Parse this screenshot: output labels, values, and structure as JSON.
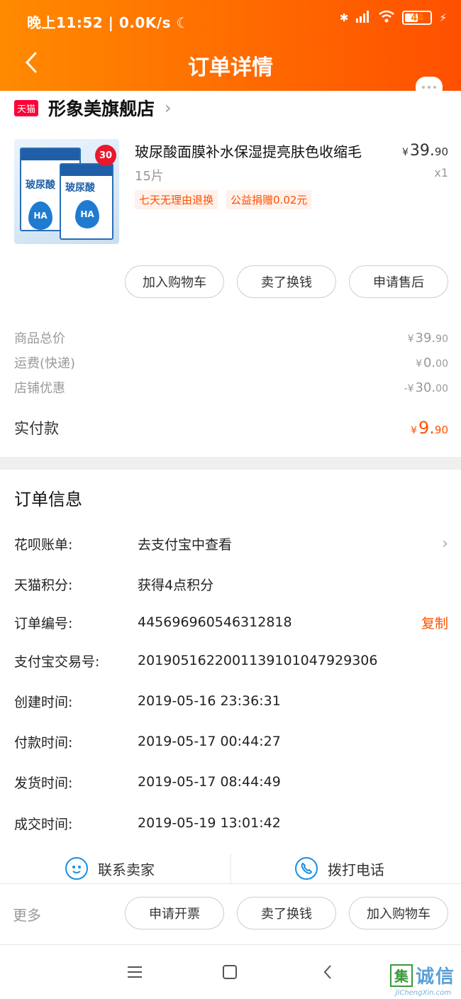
{
  "status_bar": {
    "time": "晚上11:52",
    "network_speed": "0.0K/s",
    "battery": "44"
  },
  "header": {
    "title": "订单详情",
    "gradient_start": "#ff8a00",
    "gradient_end": "#ff5000"
  },
  "store": {
    "badge": "天猫",
    "name": "形象美旗舰店"
  },
  "product": {
    "title": "玻尿酸面膜补水保湿提亮肤色收缩毛",
    "price_main": "39.",
    "price_cents": "90",
    "currency": "¥",
    "spec": "15片",
    "quantity": "x1",
    "tags": [
      "七天无理由退换",
      "公益捐赠0.02元"
    ],
    "image_text": {
      "brand_text": "玻尿酸",
      "ha_text": "HA",
      "count_badge": "30"
    }
  },
  "item_actions": [
    "加入购物车",
    "卖了换钱",
    "申请售后"
  ],
  "price_breakdown": [
    {
      "label": "商品总价",
      "prefix": "¥",
      "main": "39.",
      "cents": "90"
    },
    {
      "label": "运费(快递)",
      "prefix": "¥",
      "main": "0.",
      "cents": "00"
    },
    {
      "label": "店铺优惠",
      "prefix": "-¥",
      "main": "30.",
      "cents": "00"
    }
  ],
  "paid": {
    "label": "实付款",
    "prefix": "¥",
    "main": "9.",
    "cents": "90"
  },
  "order_info": {
    "title": "订单信息",
    "rows": [
      {
        "label": "花呗账单:",
        "value": "去支付宝中查看"
      },
      {
        "label": "天猫积分:",
        "value": "获得4点积分"
      },
      {
        "label": "订单编号:",
        "value": "445696960546312818",
        "action": "复制"
      },
      {
        "label": "支付宝交易号:",
        "value": "2019051622001139101047929306"
      },
      {
        "label": "创建时间:",
        "value": "2019-05-16 23:36:31"
      },
      {
        "label": "付款时间:",
        "value": "2019-05-17 00:44:27"
      },
      {
        "label": "发货时间:",
        "value": "2019-05-17 08:44:49"
      },
      {
        "label": "成交时间:",
        "value": "2019-05-19 13:01:42"
      }
    ]
  },
  "contact": {
    "seller": "联系卖家",
    "phone": "拨打电话"
  },
  "bottom_bar": {
    "more": "更多",
    "buttons": [
      "申请开票",
      "卖了换钱",
      "加入购物车"
    ]
  },
  "watermark": {
    "char": "集",
    "text": "诚信",
    "sub": "JiChengXin.com"
  },
  "colors": {
    "accent": "#ff5000",
    "tmall_red": "#ff0036",
    "icon_blue": "#1a8fe3"
  }
}
